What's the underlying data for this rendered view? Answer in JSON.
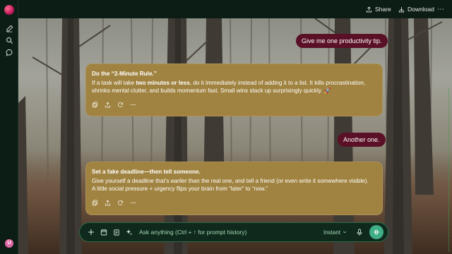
{
  "topbar": {
    "share_label": "Share",
    "download_label": "Download",
    "more_label": "⋯"
  },
  "sidebar": {
    "avatar_initial": "U",
    "icons": [
      "new-chat-icon",
      "search-icon",
      "chat-bubble-icon"
    ]
  },
  "messages": [
    {
      "role": "user",
      "text": "Give me one productivity tip."
    },
    {
      "role": "assistant",
      "title": "Do the “2-Minute Rule.”",
      "line1_pre": "If a task will take ",
      "line1_bold": "two minutes or less",
      "line1_post": ", do it immediately instead of adding it to a list. It kills procrastination,",
      "line2": "shrinks mental clutter, and builds momentum fast. Small wins stack up surprisingly quickly.",
      "emoji": "🚀"
    },
    {
      "role": "user",
      "text": "Another one."
    },
    {
      "role": "assistant",
      "title": "Set a fake deadline—then tell someone.",
      "line1_pre": "Give yourself a deadline that’s ",
      "line1_ital": "earlier",
      "line1_post": " than the real one, and tell a friend (or even write it somewhere visible).",
      "line2": "A little social pressure + urgency flips your brain from “later” to “now.”"
    }
  ],
  "composer": {
    "placeholder": "Ask anything (Ctrl + ↑ for prompt history)",
    "model_label": "Instant"
  },
  "colors": {
    "user_bubble": "#5a1027",
    "assistant_bubble": "#a08340",
    "chrome": "#0c1d15",
    "accent": "#3fae86"
  }
}
